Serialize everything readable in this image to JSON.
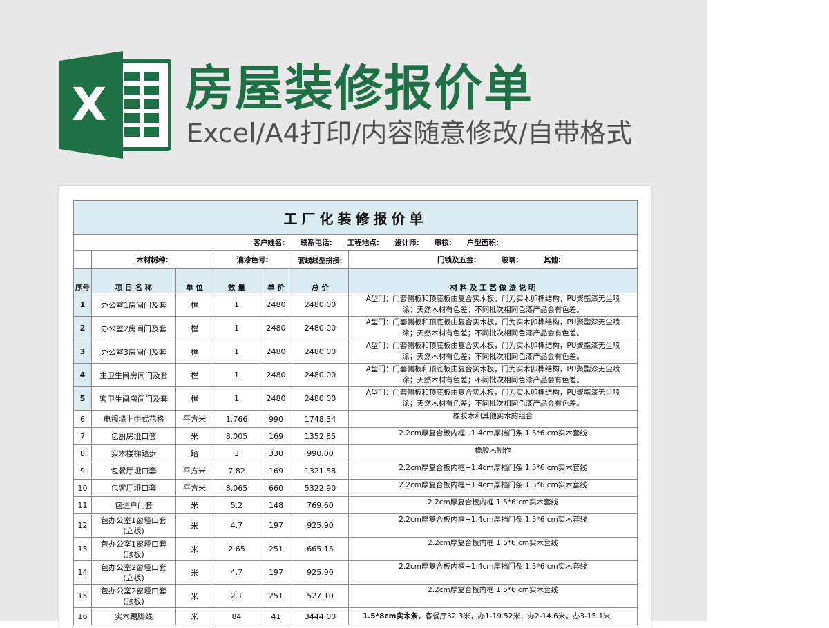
{
  "banner": {
    "title": "房屋装修报价单",
    "subtitle": "Excel/A4打印/内容随意修改/自带格式",
    "logo_letter": "X",
    "brand_color": "#1e7145",
    "logo_icon": "excel-logo-icon"
  },
  "sheet": {
    "title": "工厂化装修报价单",
    "info_row1": [
      "客户姓名:",
      "联系电话:",
      "工程地点:",
      "设计师:",
      "审核:",
      "户型面积:"
    ],
    "info_row2": {
      "wood": "木材树种:",
      "paint": "油漆色号:",
      "trim": "套线线型拼接:",
      "hardware": "门锁及五金:",
      "glass": "玻璃:",
      "other": "其他:"
    },
    "headers": {
      "no": "序号",
      "name": "项 目 名 称",
      "unit": "单 位",
      "qty": "数 量",
      "price": "单 价",
      "total": "总 价",
      "desc": "材 料 及 工 艺 做 法 说 明"
    },
    "rows": [
      {
        "no": "1",
        "name": "办公室1房间门及套",
        "unit": "樘",
        "qty": "1",
        "price": "2480",
        "total": "2480.00",
        "desc1": "A型门：门套侧板和顶底板由复合实木板，门为实木卯榫结构，PU聚酯漆无尘喷",
        "desc2": "涂；天然木材有色差；不同批次相同色漆产品会有色差。"
      },
      {
        "no": "2",
        "name": "办公室2房间门及套",
        "unit": "樘",
        "qty": "1",
        "price": "2480",
        "total": "2480.00",
        "desc1": "A型门：门套侧板和顶底板由复合实木板，门为实木卯榫结构，PU聚酯漆无尘喷",
        "desc2": "涂；天然木材有色差；不同批次相同色漆产品会有色差。"
      },
      {
        "no": "3",
        "name": "办公室3房间门及套",
        "unit": "樘",
        "qty": "1",
        "price": "2480",
        "total": "2480.00",
        "desc1": "A型门：门套侧板和顶底板由复合实木板，门为实木卯榫结构，PU聚酯漆无尘喷",
        "desc2": "涂；天然木材有色差；不同批次相同色漆产品会有色差。"
      },
      {
        "no": "4",
        "name": "主卫生间房间门及套",
        "unit": "樘",
        "qty": "1",
        "price": "2480",
        "total": "2480.00",
        "desc1": "A型门：门套侧板和顶底板由复合实木板，门为实木卯榫结构，PU聚酯漆无尘喷",
        "desc2": "涂；天然木材有色差；不同批次相同色漆产品会有色差。"
      },
      {
        "no": "5",
        "name": "客卫生间房间门及套",
        "unit": "樘",
        "qty": "1",
        "price": "2480",
        "total": "2480.00",
        "desc1": "A型门：门套侧板和顶底板由复合实木板，门为实木卯榫结构，PU聚酯漆无尘喷",
        "desc2": "涂；天然木材有色差；不同批次相同色漆产品会有色差。"
      },
      {
        "no": "6",
        "name": "电视墙上中式花格",
        "unit": "平方米",
        "qty": "1.766",
        "price": "990",
        "total": "1748.34",
        "desc1": "橡胶木和其他实木的组合"
      },
      {
        "no": "7",
        "name": "包厨房垭口套",
        "unit": "米",
        "qty": "8.005",
        "price": "169",
        "total": "1352.85",
        "desc1": "2.2cm厚复合板内框+1.4cm厚挡门条  1.5*6 cm实木套线"
      },
      {
        "no": "8",
        "name": "实木楼梯踏步",
        "unit": "踏",
        "qty": "3",
        "price": "330",
        "total": "990.00",
        "desc1": "橡胶木制作"
      },
      {
        "no": "9",
        "name": "包餐厅垭口套",
        "unit": "平方米",
        "qty": "7.82",
        "price": "169",
        "total": "1321.58",
        "desc1": "2.2cm厚复合板内框+1.4cm厚挡门条  1.5*6 cm实木套线"
      },
      {
        "no": "10",
        "name": "包客厅垭口套",
        "unit": "平方米",
        "qty": "8.065",
        "price": "660",
        "total": "5322.90",
        "desc1": "2.2cm厚复合板内框+1.4cm厚挡门条  1.5*6 cm实木套线"
      },
      {
        "no": "11",
        "name": "包进户门套",
        "unit": "米",
        "qty": "5.2",
        "price": "148",
        "total": "769.60",
        "desc1": "2.2cm厚复合板内框  1.5*6 cm实木套线"
      },
      {
        "no": "12",
        "name": "包办公室1窗垭口套",
        "name2": "(立板)",
        "unit": "米",
        "qty": "4.7",
        "price": "197",
        "total": "925.90",
        "desc1": "2.2cm厚复合板内框+1.4cm厚挡门条  1.5*6 cm实木套线"
      },
      {
        "no": "13",
        "name": "包办公室1窗垭口套",
        "name2": "(顶板)",
        "unit": "米",
        "qty": "2.65",
        "price": "251",
        "total": "665.15",
        "desc1": "2.2cm厚复合板内框  1.5*6 cm实木套线"
      },
      {
        "no": "14",
        "name": "包办公室2窗垭口套",
        "name2": "(立板)",
        "unit": "米",
        "qty": "4.7",
        "price": "197",
        "total": "925.90",
        "desc1": "2.2cm厚复合板内框+1.4cm厚挡门条  1.5*6 cm实木套线"
      },
      {
        "no": "15",
        "name": "包办公室2窗垭口套",
        "name2": "(顶板)",
        "unit": "米",
        "qty": "2.1",
        "price": "251",
        "total": "527.10",
        "desc1": "2.2cm厚复合板内框  1.5*6 cm实木套线"
      }
    ],
    "partial_row": {
      "no": "16",
      "name": "实木踢脚线",
      "unit": "米",
      "qty": "84",
      "price": "41",
      "total": "3444.00",
      "desc_bold": "1.5*8cm实木条",
      "desc1": "，客餐厅32.3米，办1-19.52米，办2-14.6米，办3-15.1米"
    }
  }
}
